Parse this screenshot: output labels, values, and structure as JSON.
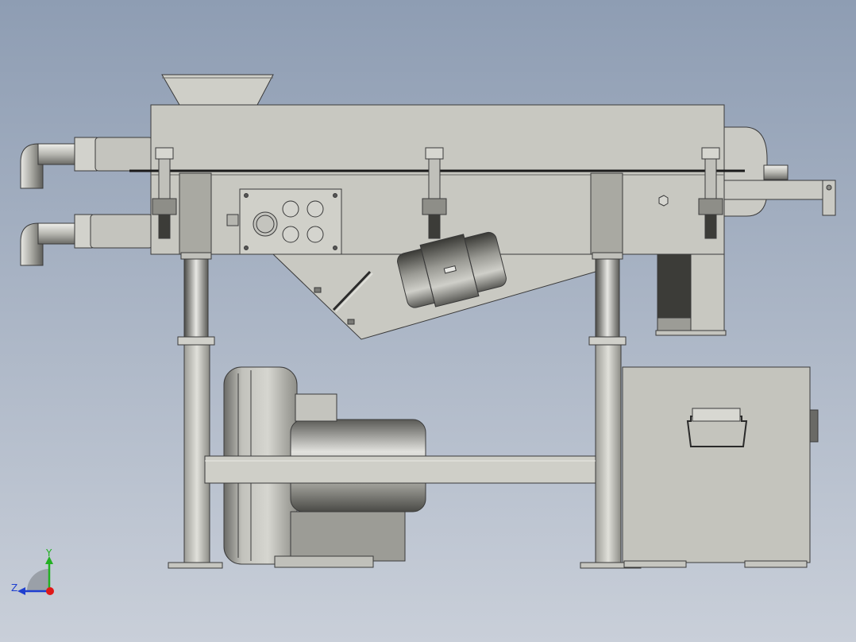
{
  "viewport": {
    "background_top": "#8e9db3",
    "background_bottom": "#c9cfd9"
  },
  "colors": {
    "body": "#c6c6bf",
    "body_dark": "#a9a9a2",
    "outline": "#3a3a3a",
    "metal_dark": "#5a5a56",
    "metal_mid": "#8a8a86",
    "metal_light": "#e4e4e0"
  },
  "triad": {
    "y_label": "Y",
    "z_label": "Z",
    "y_color": "#22b022",
    "z_color": "#1f3fd0",
    "x_color": "#e01818"
  }
}
